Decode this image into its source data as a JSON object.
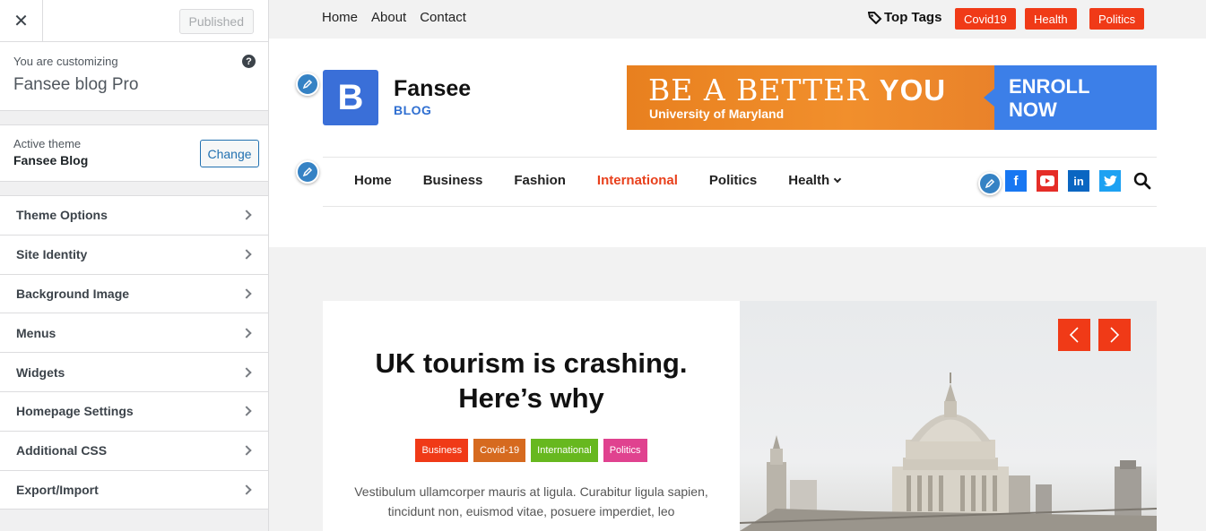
{
  "customizer": {
    "published_label": "Published",
    "customizing_label": "You are customizing",
    "site_name": "Fansee blog Pro",
    "active_theme_label": "Active theme",
    "theme_name": "Fansee Blog",
    "change_label": "Change",
    "sections": [
      {
        "label": "Theme Options"
      },
      {
        "label": "Site Identity"
      },
      {
        "label": "Background Image"
      },
      {
        "label": "Menus"
      },
      {
        "label": "Widgets"
      },
      {
        "label": "Homepage Settings"
      },
      {
        "label": "Additional CSS"
      },
      {
        "label": "Export/Import"
      }
    ]
  },
  "preview": {
    "top_nav": [
      "Home",
      "About",
      "Contact"
    ],
    "top_tags_label": "Top Tags",
    "top_tags": [
      "Covid19",
      "Health",
      "Politics"
    ],
    "logo": {
      "letter": "B",
      "title": "Fansee",
      "subtitle": "BLOG"
    },
    "banner": {
      "line1_light": "BE A BETTER ",
      "line1_bold": "YOU",
      "line2": "University of Maryland",
      "cta_line1": "ENROLL",
      "cta_line2": "NOW"
    },
    "main_nav": [
      "Home",
      "Business",
      "Fashion",
      "International",
      "Politics",
      "Health"
    ],
    "active_nav": "International",
    "social_icons": [
      "facebook-icon",
      "youtube-icon",
      "linkedin-icon",
      "twitter-icon"
    ],
    "slide": {
      "title": "UK tourism is crashing. Here’s why",
      "categories": [
        {
          "label": "Business",
          "color": "#f03a17"
        },
        {
          "label": "Covid-19",
          "color": "#d66a1f"
        },
        {
          "label": "International",
          "color": "#67b81f"
        },
        {
          "label": "Politics",
          "color": "#e0428f"
        }
      ],
      "excerpt": "Vestibulum ullamcorper mauris at ligula. Curabitur ligula sapien, tincidunt non, euismod vitae, posuere imperdiet, leo"
    }
  },
  "colors": {
    "accent": "#f03a17",
    "brand_blue": "#3a6fd8",
    "wp_blue": "#2271b1"
  }
}
